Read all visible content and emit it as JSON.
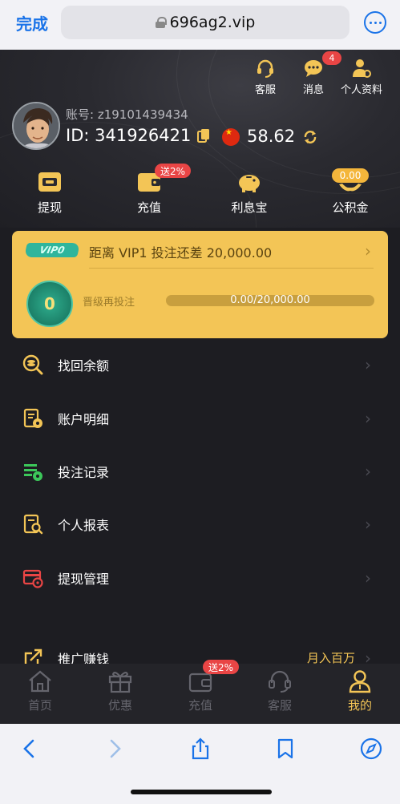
{
  "browser": {
    "done_label": "完成",
    "url": "696ag2.vip"
  },
  "top_icons": {
    "service": "客服",
    "messages": "消息",
    "messages_badge": "4",
    "profile": "个人资料"
  },
  "account": {
    "account_label": "账号: z19101439434",
    "id_label": "ID: 341926421",
    "balance": "58.62"
  },
  "actions": {
    "withdraw": "提现",
    "deposit": "充值",
    "deposit_tag": "送2%",
    "interest": "利息宝",
    "fund": "公积金",
    "fund_tag": "0.00"
  },
  "vip": {
    "badge": "VIP0",
    "goal": "距离  VIP1  投注还差 20,000.00",
    "level": "0",
    "upgrade_label": "晋级再投注",
    "progress_text": "0.00/20,000.00",
    "progress": 0.0
  },
  "menu": {
    "recover": "找回余额",
    "account_detail": "账户明细",
    "bet_record": "投注记录",
    "report": "个人报表",
    "withdraw_manage": "提现管理",
    "promo": "推广赚钱",
    "promo_extra": "月入百万"
  },
  "tabbar": {
    "home": "首页",
    "offers": "优惠",
    "deposit": "充值",
    "deposit_tag": "送2%",
    "service": "客服",
    "mine": "我的"
  },
  "colors": {
    "accent": "#f3c556",
    "badge_red": "#e94545",
    "background": "#1d1d22",
    "safari_blue": "#1a73e8"
  }
}
